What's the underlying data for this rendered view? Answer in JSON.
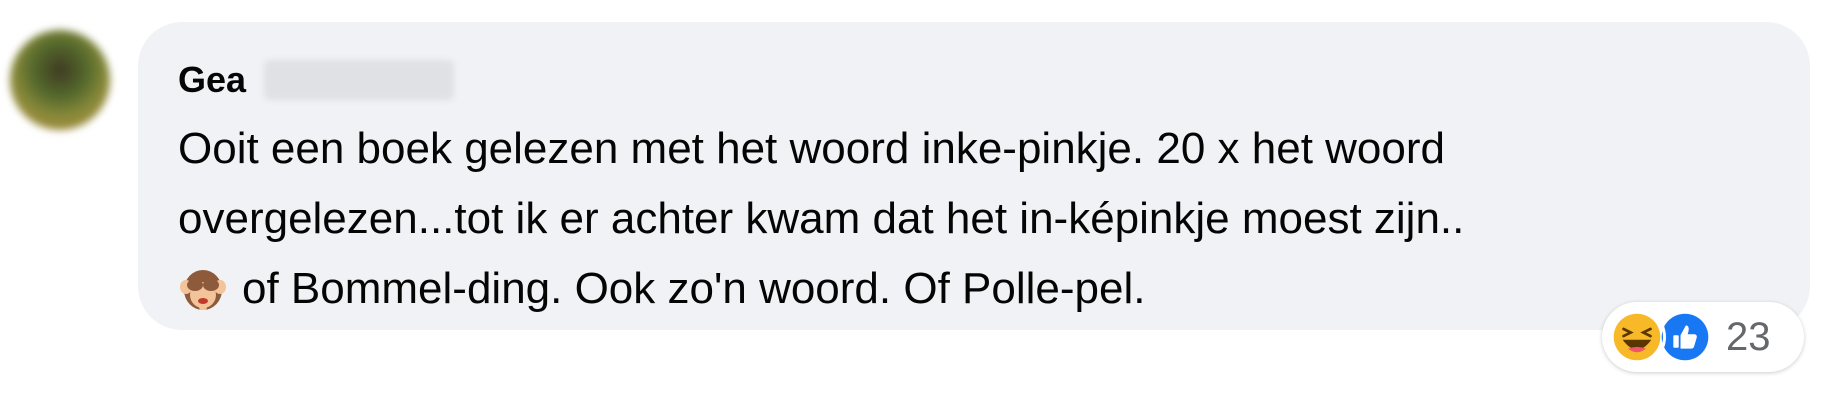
{
  "comment": {
    "author_visible": "Gea",
    "text_line1": "Ooit een boek gelezen met het woord inke-pinkje. 20 x het woord",
    "text_line2": "overgelezen...tot ik er achter kwam dat het in-képinkje moest zijn..",
    "text_line3": "of Bommel-ding. Ook zo'n woord. Of Polle-pel.",
    "emoji_icon": "see-no-evil-monkey-icon"
  },
  "reactions": {
    "icons": [
      "haha-icon",
      "like-icon"
    ],
    "count": "23",
    "colors": {
      "haha": "#f7b928",
      "like": "#1877f2",
      "bubble": "#f0f2f5",
      "count_text": "#65676b"
    }
  }
}
